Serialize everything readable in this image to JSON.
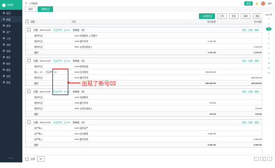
{
  "app": {
    "title": "云财务"
  },
  "sidebar": {
    "items": [
      {
        "label": "首页",
        "icon": "home-icon"
      },
      {
        "label": "凭证",
        "icon": "voucher-icon"
      },
      {
        "label": "账簿",
        "icon": "book-icon"
      },
      {
        "label": "资产",
        "icon": "asset-icon"
      },
      {
        "label": "工资",
        "icon": "salary-icon"
      },
      {
        "label": "出纳",
        "icon": "cash-icon"
      },
      {
        "label": "发票",
        "icon": "invoice-icon"
      },
      {
        "label": "报表",
        "icon": "report-icon"
      },
      {
        "label": "税务",
        "icon": "tax-icon"
      },
      {
        "label": "期末",
        "icon": "closing-icon"
      },
      {
        "label": "设置",
        "icon": "settings-icon"
      },
      {
        "label": "帮助",
        "icon": "help-icon"
      }
    ],
    "footer": "V1.0"
  },
  "topbar": {
    "company": "公司名称",
    "new_button": "新建",
    "user": "用户"
  },
  "tabs": [
    {
      "label": "首页"
    },
    {
      "label": "查看凭证"
    }
  ],
  "actions": {
    "print": "打印",
    "export": "导出",
    "audit": "审核",
    "more": "更多",
    "add": "+ 新增凭证"
  },
  "table": {
    "headers": {
      "summary": "摘要",
      "account": "科目",
      "debit": "借方金额",
      "credit": "贷方金额"
    }
  },
  "vouchers": [
    {
      "date": "日期：2021-03-25",
      "no": "凭证字号：记-002",
      "attach": "附单据：1张",
      "rows": [
        {
          "summary": "收款凭证",
          "account": "1122 应收账款_公司客户",
          "debit": "",
          "credit": ""
        },
        {
          "summary": "收款凭证",
          "account": "1002 银行存款",
          "debit": "1,012.00",
          "credit": ""
        },
        {
          "summary": "收款凭证",
          "account": "6001 主营业务收入",
          "debit": "",
          "credit": "1,012.00"
        }
      ],
      "total": {
        "label": "合计",
        "debit": "1,012.00",
        "credit": "1,012.00"
      }
    },
    {
      "date": "日期：2021-03-25",
      "no": "凭证字号：记-003",
      "attach": "附单据：1张",
      "rows": [
        {
          "summary": "收款凭证",
          "account": "1405 库存商品",
          "debit": "",
          "credit": ""
        },
        {
          "summary": "收入（2），凭证号：03",
          "account": "2202 应付账款",
          "debit": "392,209.00",
          "credit": ""
        },
        {
          "summary": "收款凭证",
          "account": "1002 银行存款",
          "debit": "",
          "credit": "392,209.00"
        }
      ],
      "total": {
        "label": "合计",
        "debit": "392,209.00",
        "credit": "392,209.00"
      }
    },
    {
      "date": "日期：2021-03-26",
      "no": "凭证字号：记-004",
      "attach": "附单据：1张",
      "rows": [
        {
          "summary": "收款凭证",
          "account": "1122 应收账款",
          "debit": "",
          "credit": ""
        },
        {
          "summary": "收款凭证",
          "account": "1002 银行存款",
          "debit": "135.60",
          "credit": ""
        },
        {
          "summary": "收款凭证",
          "account": "6001 主营业务收入",
          "debit": "",
          "credit": "135.60"
        }
      ],
      "total": {
        "label": "合计",
        "debit": "135.60",
        "credit": "135.60"
      }
    },
    {
      "date": "日期：2021-03-26",
      "no": "凭证字号：记-005",
      "attach": "附单据：1张",
      "rows": [
        {
          "summary": "资产购入",
          "account": "1601 固定资产",
          "debit": "",
          "credit": ""
        },
        {
          "summary": "资产购入",
          "account": "2221 应交税费",
          "debit": "3,000.00",
          "credit": ""
        },
        {
          "summary": "资产购入",
          "account": "1002 银行存款",
          "debit": "",
          "credit": "3,000.00"
        }
      ],
      "total": {
        "label": "合计",
        "debit": "3,000.00",
        "credit": "3,000.00"
      }
    }
  ],
  "voucher_actions": {
    "edit": "修改",
    "copy": "复制",
    "delete": "删除"
  },
  "annotation": {
    "text": "出现了新号03"
  },
  "rightpanel": {
    "date": "2021年",
    "months": [
      "1",
      "2",
      "3",
      "4",
      "5",
      "6",
      "7",
      "8",
      "9",
      "10",
      "11",
      "12"
    ],
    "active_month_index": 2
  },
  "footer": {
    "select_all": "全选",
    "page_size": "50",
    "page": "1"
  }
}
